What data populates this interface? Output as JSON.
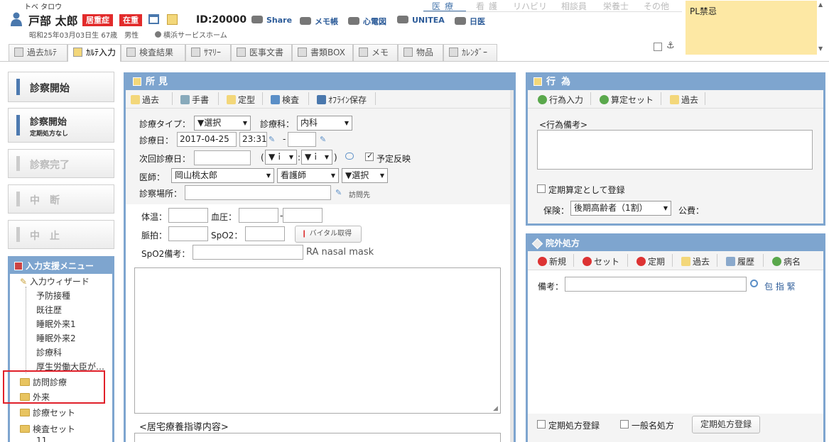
{
  "patient": {
    "kana": "トベ タロウ",
    "name": "戸部 太郎",
    "tags": [
      {
        "label": "居重症",
        "color": "#e22b2b"
      },
      {
        "label": "在重",
        "color": "#e22b2b"
      }
    ],
    "id": "ID:20000",
    "info": "昭和25年03月03日生 67歳　男性",
    "facility": "横浜サービスホーム"
  },
  "header_links": [
    "Share",
    "メモ帳",
    "心電図",
    "UNITEA",
    "日医"
  ],
  "dept_tabs": [
    "医療",
    "看護",
    "リハビリ",
    "相談員",
    "栄養士",
    "その他"
  ],
  "pl_note": "PL禁忌",
  "main_tabs": [
    "過去ｶﾙﾃ",
    "ｶﾙﾃ入力",
    "検査結果",
    "ｻﾏﾘｰ",
    "医事文書",
    "書類BOX",
    "メモ",
    "物品",
    "ｶﾚﾝﾀﾞｰ"
  ],
  "left_buttons": {
    "start": "診察開始",
    "start2": "診察開始",
    "start2_sub": "定期処方なし",
    "complete": "診察完了",
    "interrupt": "中　断",
    "stop": "中　止"
  },
  "support_menu": {
    "title": "入力支援メニュー",
    "wizard": "入力ウィザード",
    "items": [
      "予防接種",
      "既往歴",
      "睡眠外来1",
      "睡眠外来2",
      "診療科",
      "厚生労働大臣が…"
    ],
    "folders": [
      "訪問診療",
      "外来",
      "診療セット",
      "検査セット"
    ],
    "sub": "11"
  },
  "findings": {
    "title": "所見",
    "tools": [
      "過去",
      "手書",
      "定型",
      "検査",
      "ｵﾌﾗｲﾝ保存"
    ],
    "type_label": "診療タイプ：",
    "type_value": "▼選択",
    "dept_label": "診療科：",
    "dept_value": "内科",
    "date_label": "診療日：",
    "date": "2017-04-25",
    "time": "23:31",
    "time_dash": "-",
    "next_label": "次回診療日：",
    "next_open": "(",
    "next_h": "▼ｉ",
    "next_colon": ":",
    "next_m": "▼ｉ",
    "next_close": ")",
    "reflect": "予定反映",
    "doctor_label": "医師：",
    "doctor": "岡山桃太郎",
    "nurse": "看護師",
    "select": "▼選択",
    "place_label": "診察場所：",
    "visit": "訪問先",
    "temp_label": "体温：",
    "bp_label": "血圧：",
    "bp_dash": "-",
    "pulse_label": "脈拍：",
    "spo2_label": "SpO2：",
    "vital_btn": "バイタル取得",
    "spo2_note_label": "SpO2備考：",
    "spo2_note_value": "RA nasal mask",
    "home_label": "<居宅療養指導内容>"
  },
  "actions": {
    "title": "行為",
    "tools": [
      "行為入力",
      "算定セット",
      "過去"
    ],
    "note_label": "<行為備考>",
    "periodic": "定期算定として登録",
    "insurance_label": "保険：",
    "insurance_value": "後期高齢者（1割）",
    "public_label": "公費："
  },
  "rx": {
    "title": "院外処方",
    "tools": [
      "新規",
      "セット",
      "定期",
      "過去",
      "履歴",
      "病名"
    ],
    "note_label": "備考：",
    "links": "包 指 緊",
    "periodic_reg": "定期処方登録",
    "generic": "一般名処方",
    "reg_btn": "定期処方登録"
  }
}
